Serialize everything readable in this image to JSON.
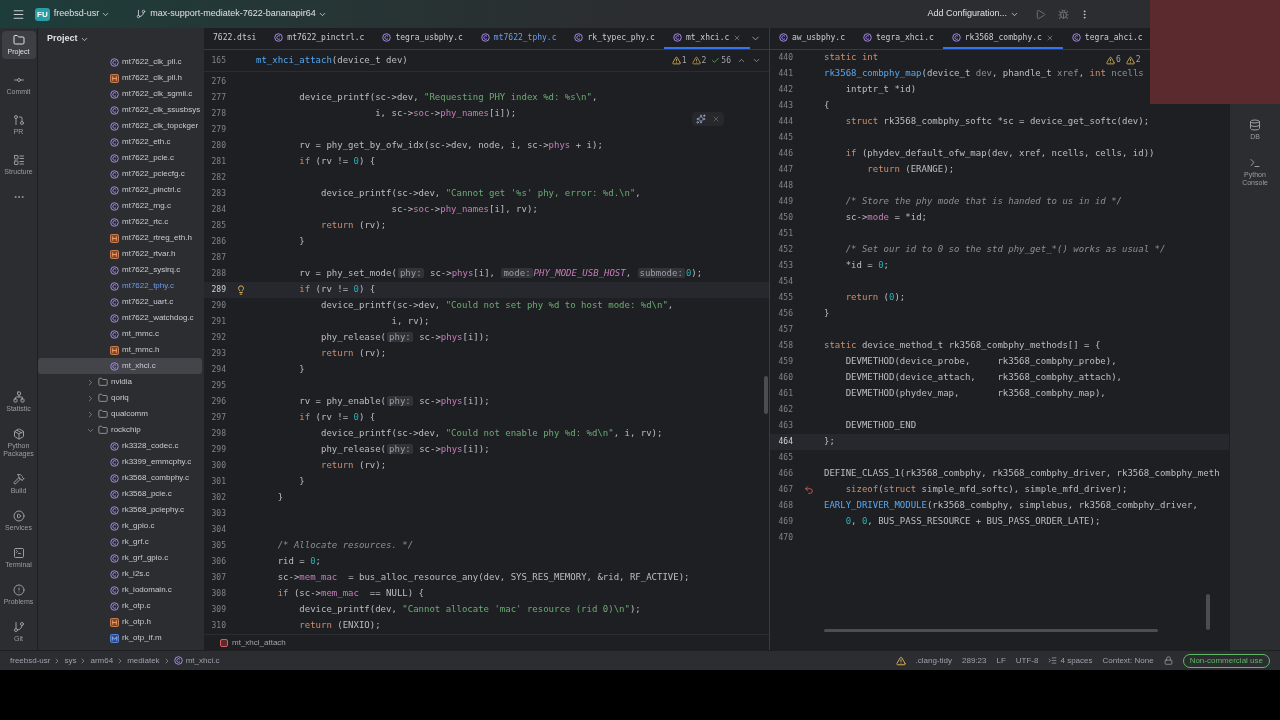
{
  "title_bar": {
    "project_badge": "FU",
    "project": "freebsd-usr",
    "branch": "max-support-mediatek-7622-bananapir64",
    "run_config": "Add Configuration..."
  },
  "tool_stripe": {
    "top": [
      {
        "label": "Project",
        "selected": true
      },
      {
        "label": "Commit",
        "selected": false
      },
      {
        "label": "PR",
        "selected": false
      },
      {
        "label": "Structure",
        "selected": false
      }
    ],
    "bottom": [
      {
        "label": "Statistic",
        "selected": false
      },
      {
        "label": "Python Packages",
        "selected": false
      },
      {
        "label": "Build",
        "selected": false
      },
      {
        "label": "Services",
        "selected": false
      },
      {
        "label": "Terminal",
        "selected": false
      },
      {
        "label": "Problems",
        "selected": false
      },
      {
        "label": "Git",
        "selected": false
      }
    ]
  },
  "right_stripe": [
    {
      "label": "DB",
      "selected": false
    },
    {
      "label": "Python Console",
      "selected": false
    }
  ],
  "project_panel": {
    "title": "Project",
    "tree": [
      {
        "name": "mt7622_clk_pll.c",
        "kind": "c",
        "selected": false,
        "vcs_modified": false
      },
      {
        "name": "mt7622_clk_pll.h",
        "kind": "h",
        "selected": false,
        "vcs_modified": false
      },
      {
        "name": "mt7622_clk_sgmii.c",
        "kind": "c",
        "selected": false,
        "vcs_modified": false
      },
      {
        "name": "mt7622_clk_ssusbsys",
        "kind": "c",
        "selected": false,
        "vcs_modified": false
      },
      {
        "name": "mt7622_clk_topckger",
        "kind": "c",
        "selected": false,
        "vcs_modified": false
      },
      {
        "name": "mt7622_eth.c",
        "kind": "c",
        "selected": false,
        "vcs_modified": false
      },
      {
        "name": "mt7622_pcie.c",
        "kind": "c",
        "selected": false,
        "vcs_modified": false
      },
      {
        "name": "mt7622_pciecfg.c",
        "kind": "c",
        "selected": false,
        "vcs_modified": false
      },
      {
        "name": "mt7622_pinctrl.c",
        "kind": "c",
        "selected": false,
        "vcs_modified": false
      },
      {
        "name": "mt7622_rng.c",
        "kind": "c",
        "selected": false,
        "vcs_modified": false
      },
      {
        "name": "mt7622_rtc.c",
        "kind": "c",
        "selected": false,
        "vcs_modified": false
      },
      {
        "name": "mt7622_rtreg_eth.h",
        "kind": "h",
        "selected": false,
        "vcs_modified": false
      },
      {
        "name": "mt7622_rtvar.h",
        "kind": "h",
        "selected": false,
        "vcs_modified": false
      },
      {
        "name": "mt7622_sysirq.c",
        "kind": "c",
        "selected": false,
        "vcs_modified": false
      },
      {
        "name": "mt7622_tphy.c",
        "kind": "c",
        "selected": false,
        "vcs_modified": true
      },
      {
        "name": "mt7622_uart.c",
        "kind": "c",
        "selected": false,
        "vcs_modified": false
      },
      {
        "name": "mt7622_watchdog.c",
        "kind": "c",
        "selected": false,
        "vcs_modified": false
      },
      {
        "name": "mt_mmc.c",
        "kind": "c",
        "selected": false,
        "vcs_modified": false
      },
      {
        "name": "mt_mmc.h",
        "kind": "h",
        "selected": false,
        "vcs_modified": false
      },
      {
        "name": "mt_xhci.c",
        "kind": "c",
        "selected": true,
        "vcs_modified": false
      },
      {
        "name": "nvidia",
        "kind": "folder",
        "selected": false,
        "vcs_modified": false,
        "expanded": false
      },
      {
        "name": "qoriq",
        "kind": "folder",
        "selected": false,
        "vcs_modified": false,
        "expanded": false
      },
      {
        "name": "qualcomm",
        "kind": "folder",
        "selected": false,
        "vcs_modified": false,
        "expanded": false
      },
      {
        "name": "rockchip",
        "kind": "folder",
        "selected": false,
        "vcs_modified": false,
        "expanded": true,
        "children": [
          {
            "name": "rk3328_codec.c",
            "kind": "c",
            "selected": false,
            "vcs_modified": false
          },
          {
            "name": "rk3399_emmcphy.c",
            "kind": "c",
            "selected": false,
            "vcs_modified": false
          },
          {
            "name": "rk3568_combphy.c",
            "kind": "c",
            "selected": false,
            "vcs_modified": false
          },
          {
            "name": "rk3568_pcie.c",
            "kind": "c",
            "selected": false,
            "vcs_modified": false
          },
          {
            "name": "rk3568_pciephy.c",
            "kind": "c",
            "selected": false,
            "vcs_modified": false
          },
          {
            "name": "rk_gpio.c",
            "kind": "c",
            "selected": false,
            "vcs_modified": false
          },
          {
            "name": "rk_grf.c",
            "kind": "c",
            "selected": false,
            "vcs_modified": false
          },
          {
            "name": "rk_grf_gpio.c",
            "kind": "c",
            "selected": false,
            "vcs_modified": false
          },
          {
            "name": "rk_i2s.c",
            "kind": "c",
            "selected": false,
            "vcs_modified": false
          },
          {
            "name": "rk_iodomain.c",
            "kind": "c",
            "selected": false,
            "vcs_modified": false
          },
          {
            "name": "rk_otp.c",
            "kind": "c",
            "selected": false,
            "vcs_modified": false
          },
          {
            "name": "rk_otp.h",
            "kind": "h",
            "selected": false,
            "vcs_modified": false
          },
          {
            "name": "rk_otp_if.m",
            "kind": "m",
            "selected": false,
            "vcs_modified": false
          }
        ]
      }
    ]
  },
  "editors": [
    {
      "tabs": [
        {
          "label": "7622.dtsi",
          "kind": "dtsi",
          "selected": false,
          "vcs_modified": false
        },
        {
          "label": "mt7622_pinctrl.c",
          "kind": "c",
          "selected": false,
          "vcs_modified": false
        },
        {
          "label": "tegra_usbphy.c",
          "kind": "c",
          "selected": false,
          "vcs_modified": false
        },
        {
          "label": "mt7622_tphy.c",
          "kind": "c",
          "selected": false,
          "vcs_modified": true
        },
        {
          "label": "rk_typec_phy.c",
          "kind": "c",
          "selected": false,
          "vcs_modified": false
        },
        {
          "label": "mt_xhci.c",
          "kind": "c",
          "selected": true,
          "vcs_modified": false
        }
      ],
      "sticky": {
        "no": "165",
        "tokens": [
          {
            "kind": "function",
            "text": "mt_xhci_attach"
          },
          {
            "kind": "plain",
            "text": "(device_t dev)"
          }
        ]
      },
      "inspections": [
        {
          "kind": "warning",
          "count": "1"
        },
        {
          "kind": "weak",
          "count": "2"
        },
        {
          "kind": "ok",
          "count": "56"
        }
      ],
      "lines": [
        {
          "no": "276",
          "current": false
        },
        {
          "no": "277",
          "current": false,
          "tokens": [
            {
              "kind": "plain",
              "text": "        device_printf(sc->dev, "
            },
            {
              "kind": "string",
              "text": "\"Requesting PHY index %d: %s\\n\""
            },
            {
              "kind": "plain",
              "text": ","
            }
          ]
        },
        {
          "no": "278",
          "current": false,
          "tokens": [
            {
              "kind": "plain",
              "text": "                      i, sc->"
            },
            {
              "kind": "field",
              "text": "soc"
            },
            {
              "kind": "plain",
              "text": "->"
            },
            {
              "kind": "field",
              "text": "phy_names"
            },
            {
              "kind": "plain",
              "text": "[i]);"
            }
          ]
        },
        {
          "no": "279",
          "current": false
        },
        {
          "no": "280",
          "current": false,
          "tokens": [
            {
              "kind": "plain",
              "text": "        rv = phy_get_by_ofw_idx(sc->dev, node, i, sc->"
            },
            {
              "kind": "field",
              "text": "phys"
            },
            {
              "kind": "plain",
              "text": " + i);"
            }
          ]
        },
        {
          "no": "281",
          "current": false,
          "tokens": [
            {
              "kind": "keyword",
              "text": "        if"
            },
            {
              "kind": "plain",
              "text": " (rv != "
            },
            {
              "kind": "number",
              "text": "0"
            },
            {
              "kind": "plain",
              "text": ") {"
            }
          ]
        },
        {
          "no": "282",
          "current": false
        },
        {
          "no": "283",
          "current": false,
          "tokens": [
            {
              "kind": "plain",
              "text": "            device_printf(sc->dev, "
            },
            {
              "kind": "string",
              "text": "\"Cannot get '%s' phy, error: %d.\\n\""
            },
            {
              "kind": "plain",
              "text": ","
            }
          ]
        },
        {
          "no": "284",
          "current": false,
          "tokens": [
            {
              "kind": "plain",
              "text": "                         sc->"
            },
            {
              "kind": "field",
              "text": "soc"
            },
            {
              "kind": "plain",
              "text": "->"
            },
            {
              "kind": "field",
              "text": "phy_names"
            },
            {
              "kind": "plain",
              "text": "[i], rv);"
            }
          ]
        },
        {
          "no": "285",
          "current": false,
          "tokens": [
            {
              "kind": "keyword",
              "text": "            return"
            },
            {
              "kind": "plain",
              "text": " (rv);"
            }
          ]
        },
        {
          "no": "286",
          "current": false,
          "tokens": [
            {
              "kind": "plain",
              "text": "        }"
            }
          ]
        },
        {
          "no": "287",
          "current": false
        },
        {
          "no": "288",
          "current": false,
          "tokens": [
            {
              "kind": "plain",
              "text": "        rv = phy_set_mode("
            },
            {
              "kind": "hint",
              "text": "phy:"
            },
            {
              "kind": "plain",
              "text": " sc->"
            },
            {
              "kind": "field",
              "text": "phys"
            },
            {
              "kind": "plain",
              "text": "[i], "
            },
            {
              "kind": "hint",
              "text": "mode:"
            },
            {
              "kind": "constant",
              "text": "PHY_MODE_USB_HOST"
            },
            {
              "kind": "plain",
              "text": ", "
            },
            {
              "kind": "hint",
              "text": "submode:"
            },
            {
              "kind": "number",
              "text": "0"
            },
            {
              "kind": "plain",
              "text": ");"
            }
          ]
        },
        {
          "no": "289",
          "current": true,
          "kind": "bulb",
          "tokens": [
            {
              "kind": "keyword",
              "text": "        if"
            },
            {
              "kind": "plain",
              "text": " (rv != "
            },
            {
              "kind": "number",
              "text": "0"
            },
            {
              "kind": "plain",
              "text": ") {"
            }
          ]
        },
        {
          "no": "290",
          "current": false,
          "tokens": [
            {
              "kind": "plain",
              "text": "            device_printf(sc->dev, "
            },
            {
              "kind": "string",
              "text": "\"Could not set phy %d to host mode: %d\\n\""
            },
            {
              "kind": "plain",
              "text": ","
            }
          ]
        },
        {
          "no": "291",
          "current": false,
          "tokens": [
            {
              "kind": "plain",
              "text": "                         i, rv);"
            }
          ]
        },
        {
          "no": "292",
          "current": false,
          "tokens": [
            {
              "kind": "plain",
              "text": "            phy_release("
            },
            {
              "kind": "hint",
              "text": "phy:"
            },
            {
              "kind": "plain",
              "text": " sc->"
            },
            {
              "kind": "field",
              "text": "phys"
            },
            {
              "kind": "plain",
              "text": "[i]);"
            }
          ]
        },
        {
          "no": "293",
          "current": false,
          "tokens": [
            {
              "kind": "keyword",
              "text": "            return"
            },
            {
              "kind": "plain",
              "text": " (rv);"
            }
          ]
        },
        {
          "no": "294",
          "current": false,
          "tokens": [
            {
              "kind": "plain",
              "text": "        }"
            }
          ]
        },
        {
          "no": "295",
          "current": false
        },
        {
          "no": "296",
          "current": false,
          "tokens": [
            {
              "kind": "plain",
              "text": "        rv = phy_enable("
            },
            {
              "kind": "hint",
              "text": "phy:"
            },
            {
              "kind": "plain",
              "text": " sc->"
            },
            {
              "kind": "field",
              "text": "phys"
            },
            {
              "kind": "plain",
              "text": "[i]);"
            }
          ]
        },
        {
          "no": "297",
          "current": false,
          "tokens": [
            {
              "kind": "keyword",
              "text": "        if"
            },
            {
              "kind": "plain",
              "text": " (rv != "
            },
            {
              "kind": "number",
              "text": "0"
            },
            {
              "kind": "plain",
              "text": ") {"
            }
          ]
        },
        {
          "no": "298",
          "current": false,
          "tokens": [
            {
              "kind": "plain",
              "text": "            device_printf(sc->dev, "
            },
            {
              "kind": "string",
              "text": "\"Could not enable phy %d: %d\\n\""
            },
            {
              "kind": "plain",
              "text": ", i, rv);"
            }
          ]
        },
        {
          "no": "299",
          "current": false,
          "tokens": [
            {
              "kind": "plain",
              "text": "            phy_release("
            },
            {
              "kind": "hint",
              "text": "phy:"
            },
            {
              "kind": "plain",
              "text": " sc->"
            },
            {
              "kind": "field",
              "text": "phys"
            },
            {
              "kind": "plain",
              "text": "[i]);"
            }
          ]
        },
        {
          "no": "300",
          "current": false,
          "tokens": [
            {
              "kind": "keyword",
              "text": "            return"
            },
            {
              "kind": "plain",
              "text": " (rv);"
            }
          ]
        },
        {
          "no": "301",
          "current": false,
          "tokens": [
            {
              "kind": "plain",
              "text": "        }"
            }
          ]
        },
        {
          "no": "302",
          "current": false,
          "tokens": [
            {
              "kind": "plain",
              "text": "    }"
            }
          ]
        },
        {
          "no": "303",
          "current": false
        },
        {
          "no": "304",
          "current": false
        },
        {
          "no": "305",
          "current": false,
          "tokens": [
            {
              "kind": "comment",
              "text": "    /* Allocate resources. */"
            }
          ]
        },
        {
          "no": "306",
          "current": false,
          "tokens": [
            {
              "kind": "plain",
              "text": "    rid = "
            },
            {
              "kind": "number",
              "text": "0"
            },
            {
              "kind": "plain",
              "text": ";"
            }
          ]
        },
        {
          "no": "307",
          "current": false,
          "tokens": [
            {
              "kind": "plain",
              "text": "    sc->"
            },
            {
              "kind": "field",
              "text": "mem_mac"
            },
            {
              "kind": "plain",
              "text": "  = bus_alloc_resource_any(dev, SYS_RES_MEMORY, &rid, RF_ACTIVE);"
            }
          ]
        },
        {
          "no": "308",
          "current": false,
          "tokens": [
            {
              "kind": "keyword",
              "text": "    if"
            },
            {
              "kind": "plain",
              "text": " (sc->"
            },
            {
              "kind": "field",
              "text": "mem_mac"
            },
            {
              "kind": "plain",
              "text": "  == NULL) {"
            }
          ]
        },
        {
          "no": "309",
          "current": false,
          "tokens": [
            {
              "kind": "plain",
              "text": "        device_printf(dev, "
            },
            {
              "kind": "string",
              "text": "\"Cannot allocate 'mac' resource (rid 0)\\n\""
            },
            {
              "kind": "plain",
              "text": ");"
            }
          ]
        },
        {
          "no": "310",
          "current": false,
          "tokens": [
            {
              "kind": "keyword",
              "text": "        return"
            },
            {
              "kind": "plain",
              "text": " (ENXIO);"
            }
          ]
        }
      ],
      "breadcrumb": "mt_xhci_attach"
    },
    {
      "tabs": [
        {
          "label": "aw_usbphy.c",
          "kind": "c",
          "selected": false,
          "vcs_modified": false
        },
        {
          "label": "tegra_xhci.c",
          "kind": "c",
          "selected": false,
          "vcs_modified": false
        },
        {
          "label": "rk3568_combphy.c",
          "kind": "c",
          "selected": true,
          "vcs_modified": false
        },
        {
          "label": "tegra_ahci.c",
          "kind": "c",
          "selected": false,
          "vcs_modified": false
        }
      ],
      "inspections": [
        {
          "kind": "warning",
          "count": "6"
        },
        {
          "kind": "warning",
          "count": "2"
        }
      ],
      "lines": [
        {
          "no": "440",
          "current": false,
          "tokens": [
            {
              "kind": "keyword",
              "text": "static int"
            }
          ]
        },
        {
          "no": "441",
          "current": false,
          "tokens": [
            {
              "kind": "function",
              "text": "rk3568_combphy_map"
            },
            {
              "kind": "plain",
              "text": "(device_t "
            },
            {
              "kind": "unused",
              "text": "dev"
            },
            {
              "kind": "plain",
              "text": ", phandle_t "
            },
            {
              "kind": "unused",
              "text": "xref"
            },
            {
              "kind": "plain",
              "text": ", "
            },
            {
              "kind": "keyword",
              "text": "int"
            },
            {
              "kind": "unused",
              "text": " ncells"
            }
          ]
        },
        {
          "no": "442",
          "current": false,
          "tokens": [
            {
              "kind": "plain",
              "text": "    intptr_t *id)"
            }
          ]
        },
        {
          "no": "443",
          "current": false,
          "tokens": [
            {
              "kind": "plain",
              "text": "{"
            }
          ]
        },
        {
          "no": "444",
          "current": false,
          "tokens": [
            {
              "kind": "keyword",
              "text": "    struct"
            },
            {
              "kind": "plain",
              "text": " rk3568_combphy_softc *sc = device_get_softc(dev);"
            }
          ]
        },
        {
          "no": "445",
          "current": false
        },
        {
          "no": "446",
          "current": false,
          "tokens": [
            {
              "kind": "keyword",
              "text": "    if"
            },
            {
              "kind": "plain",
              "text": " (phydev_default_ofw_map(dev, xref, ncells, cells, id))"
            }
          ]
        },
        {
          "no": "447",
          "current": false,
          "tokens": [
            {
              "kind": "keyword",
              "text": "        return"
            },
            {
              "kind": "plain",
              "text": " (ERANGE);"
            }
          ]
        },
        {
          "no": "448",
          "current": false
        },
        {
          "no": "449",
          "current": false,
          "tokens": [
            {
              "kind": "comment",
              "text": "    /* Store the phy mode that is handed to us in id */"
            }
          ]
        },
        {
          "no": "450",
          "current": false,
          "tokens": [
            {
              "kind": "plain",
              "text": "    sc->"
            },
            {
              "kind": "field",
              "text": "mode"
            },
            {
              "kind": "plain",
              "text": " = *id;"
            }
          ]
        },
        {
          "no": "451",
          "current": false
        },
        {
          "no": "452",
          "current": false,
          "tokens": [
            {
              "kind": "comment",
              "text": "    /* Set our id to 0 so the std phy_get_*() works as usual */"
            }
          ]
        },
        {
          "no": "453",
          "current": false,
          "tokens": [
            {
              "kind": "plain",
              "text": "    *id = "
            },
            {
              "kind": "number",
              "text": "0"
            },
            {
              "kind": "plain",
              "text": ";"
            }
          ]
        },
        {
          "no": "454",
          "current": false
        },
        {
          "no": "455",
          "current": false,
          "tokens": [
            {
              "kind": "keyword",
              "text": "    return"
            },
            {
              "kind": "plain",
              "text": " ("
            },
            {
              "kind": "number",
              "text": "0"
            },
            {
              "kind": "plain",
              "text": ");"
            }
          ]
        },
        {
          "no": "456",
          "current": false,
          "tokens": [
            {
              "kind": "plain",
              "text": "}"
            }
          ]
        },
        {
          "no": "457",
          "current": false
        },
        {
          "no": "458",
          "current": false,
          "tokens": [
            {
              "kind": "keyword",
              "text": "static"
            },
            {
              "kind": "plain",
              "text": " device_method_t rk3568_combphy_methods[] = {"
            }
          ]
        },
        {
          "no": "459",
          "current": false,
          "tokens": [
            {
              "kind": "plain",
              "text": "    DEVMETHOD(device_probe,     rk3568_combphy_probe),"
            }
          ]
        },
        {
          "no": "460",
          "current": false,
          "tokens": [
            {
              "kind": "plain",
              "text": "    DEVMETHOD(device_attach,    rk3568_combphy_attach),"
            }
          ]
        },
        {
          "no": "461",
          "current": false,
          "tokens": [
            {
              "kind": "plain",
              "text": "    DEVMETHOD(phydev_map,       rk3568_combphy_map),"
            }
          ]
        },
        {
          "no": "462",
          "current": false
        },
        {
          "no": "463",
          "current": false,
          "tokens": [
            {
              "kind": "plain",
              "text": "    DEVMETHOD_END"
            }
          ]
        },
        {
          "no": "464",
          "current": true,
          "tokens": [
            {
              "kind": "plain",
              "text": "};"
            }
          ]
        },
        {
          "no": "465",
          "current": false
        },
        {
          "no": "466",
          "current": false,
          "tokens": [
            {
              "kind": "plain",
              "text": "DEFINE_CLASS_1(rk3568_combphy, rk3568_combphy_driver, rk3568_combphy_meth"
            }
          ]
        },
        {
          "no": "467",
          "current": false,
          "kind": "arrow",
          "tokens": [
            {
              "kind": "keyword",
              "text": "    sizeof"
            },
            {
              "kind": "plain",
              "text": "("
            },
            {
              "kind": "keyword",
              "text": "struct"
            },
            {
              "kind": "plain",
              "text": " simple_mfd_softc), simple_mfd_driver);"
            }
          ]
        },
        {
          "no": "468",
          "current": false,
          "tokens": [
            {
              "kind": "function",
              "text": "EARLY_DRIVER_MODULE"
            },
            {
              "kind": "plain",
              "text": "(rk3568_combphy, simplebus, rk3568_combphy_driver,"
            }
          ]
        },
        {
          "no": "469",
          "current": false,
          "tokens": [
            {
              "kind": "number",
              "text": "    0"
            },
            {
              "kind": "plain",
              "text": ", "
            },
            {
              "kind": "number",
              "text": "0"
            },
            {
              "kind": "plain",
              "text": ", BUS_PASS_RESOURCE + BUS_PASS_ORDER_LATE);"
            }
          ]
        },
        {
          "no": "470",
          "current": false
        }
      ]
    }
  ],
  "status_bar": {
    "path": [
      "freebsd-usr",
      "sys",
      "arm64",
      "mediatek",
      "mt_xhci.c"
    ],
    "items": [
      ".clang-tidy",
      "289:23",
      "LF",
      "UTF-8",
      "4 spaces",
      "Context: None"
    ],
    "license": "Non-commercial use"
  }
}
